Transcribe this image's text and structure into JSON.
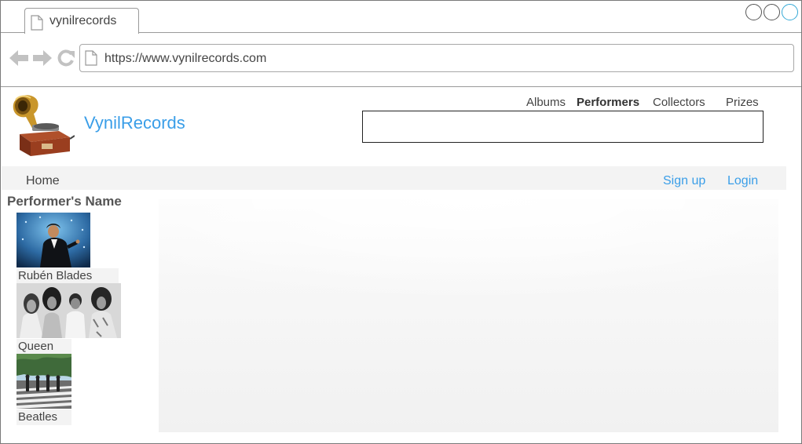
{
  "browser": {
    "tab_title": "vynilrecords",
    "url": "https://www.vynilrecords.com",
    "window_controls": [
      "minimize",
      "maximize",
      "close"
    ]
  },
  "header": {
    "brand": "VynilRecords",
    "logo_icon": "gramophone-icon",
    "nav": [
      {
        "label": "Albums",
        "active": false
      },
      {
        "label": "Performers",
        "active": true
      },
      {
        "label": "Collectors",
        "active": false
      },
      {
        "label": "Prizes",
        "active": false
      }
    ],
    "search_value": ""
  },
  "subnav": {
    "home": "Home",
    "signup": "Sign up",
    "login": "Login"
  },
  "sidebar": {
    "title": "Performer's Name",
    "performers": [
      {
        "name": "Rubén Blades"
      },
      {
        "name": "Queen"
      },
      {
        "name": "Beatles"
      }
    ]
  },
  "colors": {
    "link": "#3a9ee8",
    "accent_window_button": "#35a9d6",
    "nav_bar": "#f3f3f3"
  }
}
